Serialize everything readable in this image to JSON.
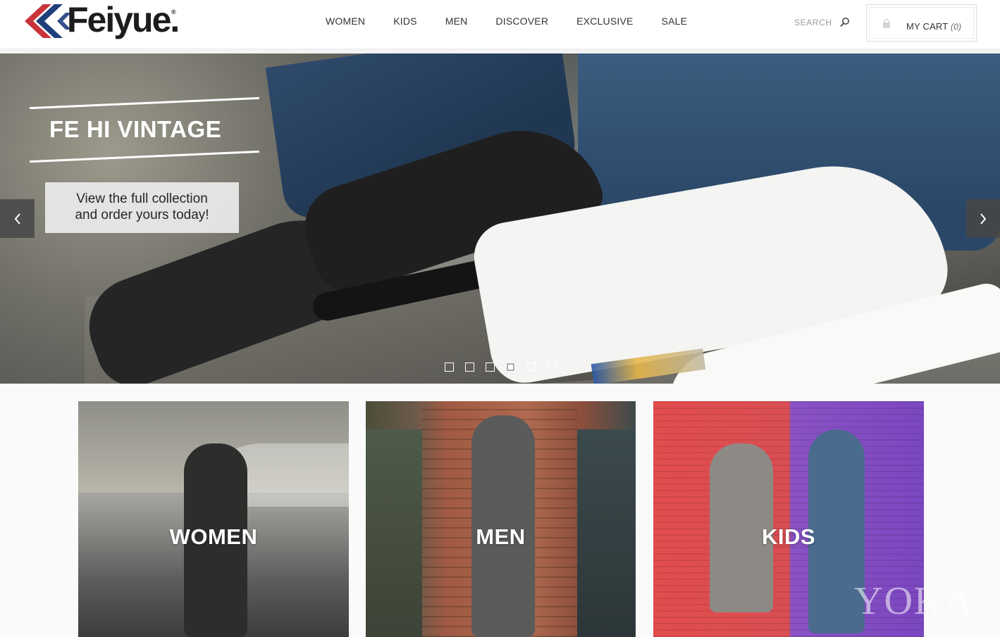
{
  "brand": {
    "name": "Feiyue.",
    "reg": "®",
    "colors": {
      "red": "#c8343a",
      "blue": "#1e3f7a",
      "dark": "#1d1d1d"
    }
  },
  "nav": {
    "items": [
      "WOMEN",
      "KIDS",
      "MEN",
      "DISCOVER",
      "EXCLUSIVE",
      "SALE"
    ]
  },
  "search": {
    "label": "SEARCH",
    "icon": "search-icon"
  },
  "cart": {
    "label": "MY CART",
    "count": "(0)",
    "icon": "shopping-bag-icon"
  },
  "hero": {
    "title": "FE HI VINTAGE",
    "cta_line1": "View the full collection",
    "cta_line2": "and order yours today!",
    "prev_icon": "chevron-left-icon",
    "next_icon": "chevron-right-icon",
    "slide_count": 6,
    "active_slide": 4
  },
  "categories": [
    {
      "label": "WOMEN"
    },
    {
      "label": "MEN"
    },
    {
      "label": "KIDS"
    }
  ],
  "watermark": "YOKA"
}
